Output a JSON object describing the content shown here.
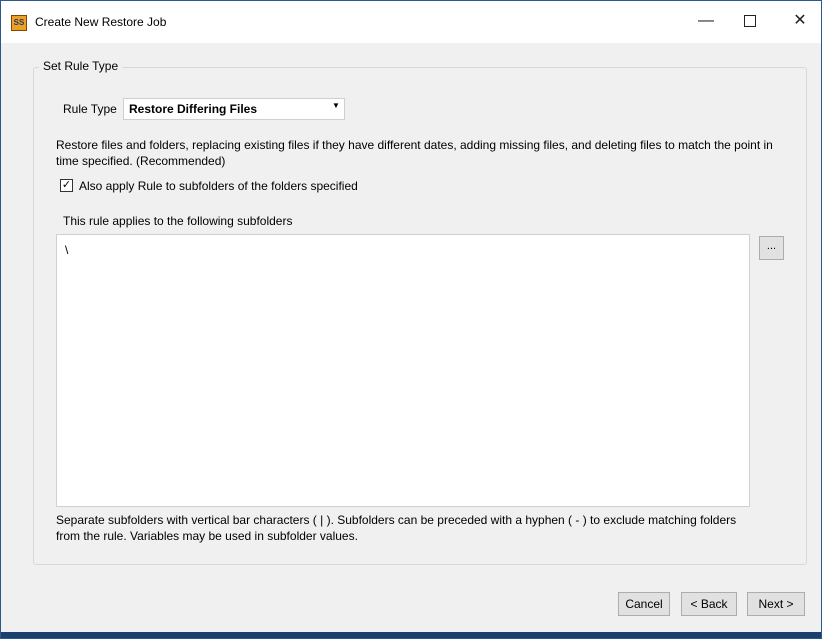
{
  "window": {
    "title": "Create New Restore Job",
    "app_icon_text": "SS",
    "minimize_glyph": "—",
    "close_glyph": "✕"
  },
  "group": {
    "label": "Set Rule Type"
  },
  "rule_type": {
    "label": "Rule Type",
    "selected": "Restore Differing Files",
    "arrow": "▼"
  },
  "description": "Restore files and folders, replacing existing files if they have different dates, adding missing files, and deleting files to match the point in time specified. (Recommended)",
  "subfolder_option": {
    "checked": true,
    "check_glyph": "✓",
    "label": "Also apply Rule to subfolders of the folders specified"
  },
  "subfolders": {
    "label": "This rule applies to the following subfolders",
    "value": "\\",
    "browse_label": "..."
  },
  "help_text": "Separate subfolders with vertical bar characters ( | ). Subfolders can be preceded with a hyphen ( - ) to exclude matching folders from the rule. Variables may be used in subfolder values.",
  "buttons": {
    "cancel": "Cancel",
    "back": "< Back",
    "next": "Next >"
  }
}
